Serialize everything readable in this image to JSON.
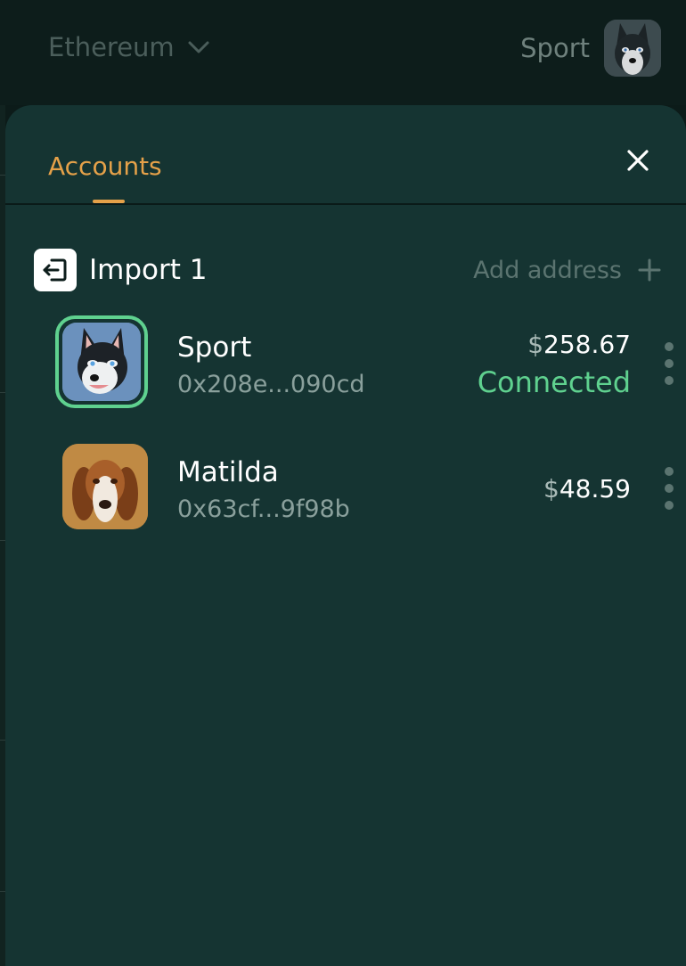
{
  "header": {
    "network": "Ethereum",
    "account_name": "Sport"
  },
  "panel": {
    "tab_label": "Accounts",
    "group": {
      "title": "Import 1",
      "add_label": "Add address"
    },
    "accounts": [
      {
        "name": "Sport",
        "address": "0x208e...090cd",
        "balance_symbol": "$",
        "balance": "258.67",
        "status": "Connected"
      },
      {
        "name": "Matilda",
        "address": "0x63cf...9f98b",
        "balance_symbol": "$",
        "balance": "48.59",
        "status": ""
      }
    ]
  },
  "icons": {
    "network_caret": "chevron-down-icon",
    "close": "close-icon",
    "import": "import-icon",
    "add": "plus-icon",
    "menu": "kebab-menu-icon"
  },
  "colors": {
    "accent": "#e5a149",
    "connected": "#5fd18f",
    "panel_bg": "#153432",
    "page_bg": "#0c1b19"
  }
}
